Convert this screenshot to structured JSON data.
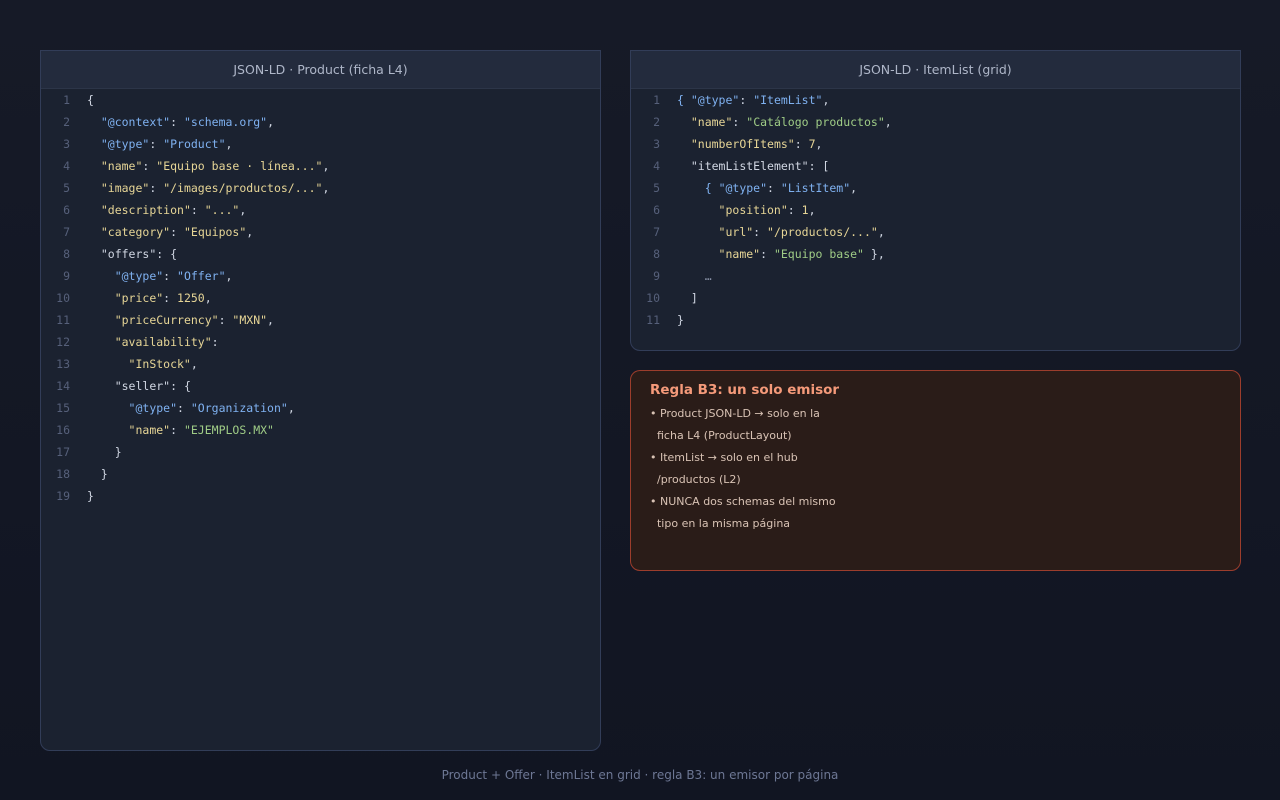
{
  "product_panel": {
    "title": "JSON-LD · Product (ficha L4)",
    "lines": [
      {
        "n": "1",
        "parts": [
          [
            "p",
            "{"
          ]
        ]
      },
      {
        "n": "2",
        "parts": [
          [
            "p",
            "  "
          ],
          [
            "t",
            "\"@context\""
          ],
          [
            "p",
            ": "
          ],
          [
            "t",
            "\"schema.org\""
          ],
          [
            "p",
            ","
          ]
        ]
      },
      {
        "n": "3",
        "parts": [
          [
            "p",
            "  "
          ],
          [
            "t",
            "\"@type\""
          ],
          [
            "p",
            ": "
          ],
          [
            "t",
            "\"Product\""
          ],
          [
            "p",
            ","
          ]
        ]
      },
      {
        "n": "4",
        "parts": [
          [
            "p",
            "  "
          ],
          [
            "k",
            "\"name\""
          ],
          [
            "p",
            ": "
          ],
          [
            "k",
            "\"Equipo base · línea...\""
          ],
          [
            "p",
            ","
          ]
        ]
      },
      {
        "n": "5",
        "parts": [
          [
            "p",
            "  "
          ],
          [
            "k",
            "\"image\""
          ],
          [
            "p",
            ": "
          ],
          [
            "k",
            "\"/images/productos/...\""
          ],
          [
            "p",
            ","
          ]
        ]
      },
      {
        "n": "6",
        "parts": [
          [
            "p",
            "  "
          ],
          [
            "k",
            "\"description\""
          ],
          [
            "p",
            ": "
          ],
          [
            "k",
            "\"...\""
          ],
          [
            "p",
            ","
          ]
        ]
      },
      {
        "n": "7",
        "parts": [
          [
            "p",
            "  "
          ],
          [
            "k",
            "\"category\""
          ],
          [
            "p",
            ": "
          ],
          [
            "k",
            "\"Equipos\""
          ],
          [
            "p",
            ","
          ]
        ]
      },
      {
        "n": "8",
        "parts": [
          [
            "p",
            "  "
          ],
          [
            "p",
            "\"offers\""
          ],
          [
            "p",
            ": {"
          ]
        ]
      },
      {
        "n": "9",
        "parts": [
          [
            "p",
            "    "
          ],
          [
            "t",
            "\"@type\""
          ],
          [
            "p",
            ": "
          ],
          [
            "t",
            "\"Offer\""
          ],
          [
            "p",
            ","
          ]
        ]
      },
      {
        "n": "10",
        "parts": [
          [
            "p",
            "    "
          ],
          [
            "k",
            "\"price\""
          ],
          [
            "p",
            ": "
          ],
          [
            "n",
            "1250"
          ],
          [
            "p",
            ","
          ]
        ]
      },
      {
        "n": "11",
        "parts": [
          [
            "p",
            "    "
          ],
          [
            "k",
            "\"priceCurrency\""
          ],
          [
            "p",
            ": "
          ],
          [
            "k",
            "\"MXN\""
          ],
          [
            "p",
            ","
          ]
        ]
      },
      {
        "n": "12",
        "parts": [
          [
            "p",
            "    "
          ],
          [
            "k",
            "\"availability\""
          ],
          [
            "p",
            ":"
          ]
        ]
      },
      {
        "n": "13",
        "parts": [
          [
            "p",
            "      "
          ],
          [
            "k",
            "\"InStock\""
          ],
          [
            "p",
            ","
          ]
        ]
      },
      {
        "n": "14",
        "parts": [
          [
            "p",
            "    "
          ],
          [
            "p",
            "\"seller\""
          ],
          [
            "p",
            ": {"
          ]
        ]
      },
      {
        "n": "15",
        "parts": [
          [
            "p",
            "      "
          ],
          [
            "t",
            "\"@type\""
          ],
          [
            "p",
            ": "
          ],
          [
            "t",
            "\"Organization\""
          ],
          [
            "p",
            ","
          ]
        ]
      },
      {
        "n": "16",
        "parts": [
          [
            "p",
            "      "
          ],
          [
            "k",
            "\"name\""
          ],
          [
            "p",
            ": "
          ],
          [
            "s",
            "\"EJEMPLOS.MX\""
          ]
        ]
      },
      {
        "n": "17",
        "parts": [
          [
            "p",
            "    }"
          ]
        ]
      },
      {
        "n": "18",
        "parts": [
          [
            "p",
            "  }"
          ]
        ]
      },
      {
        "n": "19",
        "parts": [
          [
            "p",
            "}"
          ]
        ]
      }
    ]
  },
  "itemlist_panel": {
    "title": "JSON-LD · ItemList (grid)",
    "lines": [
      {
        "n": "1",
        "parts": [
          [
            "t",
            "{ "
          ],
          [
            "t",
            "\"@type\""
          ],
          [
            "p",
            ": "
          ],
          [
            "t",
            "\"ItemList\""
          ],
          [
            "p",
            ","
          ]
        ]
      },
      {
        "n": "2",
        "parts": [
          [
            "p",
            "  "
          ],
          [
            "k",
            "\"name\""
          ],
          [
            "p",
            ": "
          ],
          [
            "s",
            "\"Catálogo productos\""
          ],
          [
            "p",
            ","
          ]
        ]
      },
      {
        "n": "3",
        "parts": [
          [
            "p",
            "  "
          ],
          [
            "k",
            "\"numberOfItems\""
          ],
          [
            "p",
            ": "
          ],
          [
            "n",
            "7"
          ],
          [
            "p",
            ","
          ]
        ]
      },
      {
        "n": "4",
        "parts": [
          [
            "p",
            "  "
          ],
          [
            "p",
            "\"itemListElement\""
          ],
          [
            "p",
            ": ["
          ]
        ]
      },
      {
        "n": "5",
        "parts": [
          [
            "p",
            "    "
          ],
          [
            "t",
            "{ "
          ],
          [
            "t",
            "\"@type\""
          ],
          [
            "p",
            ": "
          ],
          [
            "t",
            "\"ListItem\""
          ],
          [
            "p",
            ","
          ]
        ]
      },
      {
        "n": "6",
        "parts": [
          [
            "p",
            "      "
          ],
          [
            "k",
            "\"position\""
          ],
          [
            "p",
            ": "
          ],
          [
            "n",
            "1"
          ],
          [
            "p",
            ","
          ]
        ]
      },
      {
        "n": "7",
        "parts": [
          [
            "p",
            "      "
          ],
          [
            "k",
            "\"url\""
          ],
          [
            "p",
            ": "
          ],
          [
            "k",
            "\"/productos/...\""
          ],
          [
            "p",
            ","
          ]
        ]
      },
      {
        "n": "8",
        "parts": [
          [
            "p",
            "      "
          ],
          [
            "k",
            "\"name\""
          ],
          [
            "p",
            ": "
          ],
          [
            "s",
            "\"Equipo base\""
          ],
          [
            "p",
            " },"
          ]
        ]
      },
      {
        "n": "9",
        "parts": [
          [
            "p",
            "    "
          ],
          [
            "m",
            "…"
          ]
        ]
      },
      {
        "n": "10",
        "parts": [
          [
            "p",
            "  ]"
          ]
        ]
      },
      {
        "n": "11",
        "parts": [
          [
            "p",
            "}"
          ]
        ]
      }
    ]
  },
  "rule": {
    "title": "Regla B3: un solo emisor",
    "lines": [
      "• Product JSON-LD → solo en la",
      "  ficha L4 (ProductLayout)",
      "• ItemList → solo en el hub",
      "  /productos (L2)",
      "• NUNCA dos schemas del mismo",
      "  tipo en la misma página"
    ]
  },
  "caption": "Product + Offer · ItemList en grid · regla B3: un emisor por página",
  "colors": {
    "background": "#131826",
    "panel": "#1b2230",
    "key": "#e6d596",
    "string": "#9fcc86",
    "type": "#7fb1f0",
    "rule_border": "#9c3d2c",
    "rule_title": "#f59a7a"
  }
}
